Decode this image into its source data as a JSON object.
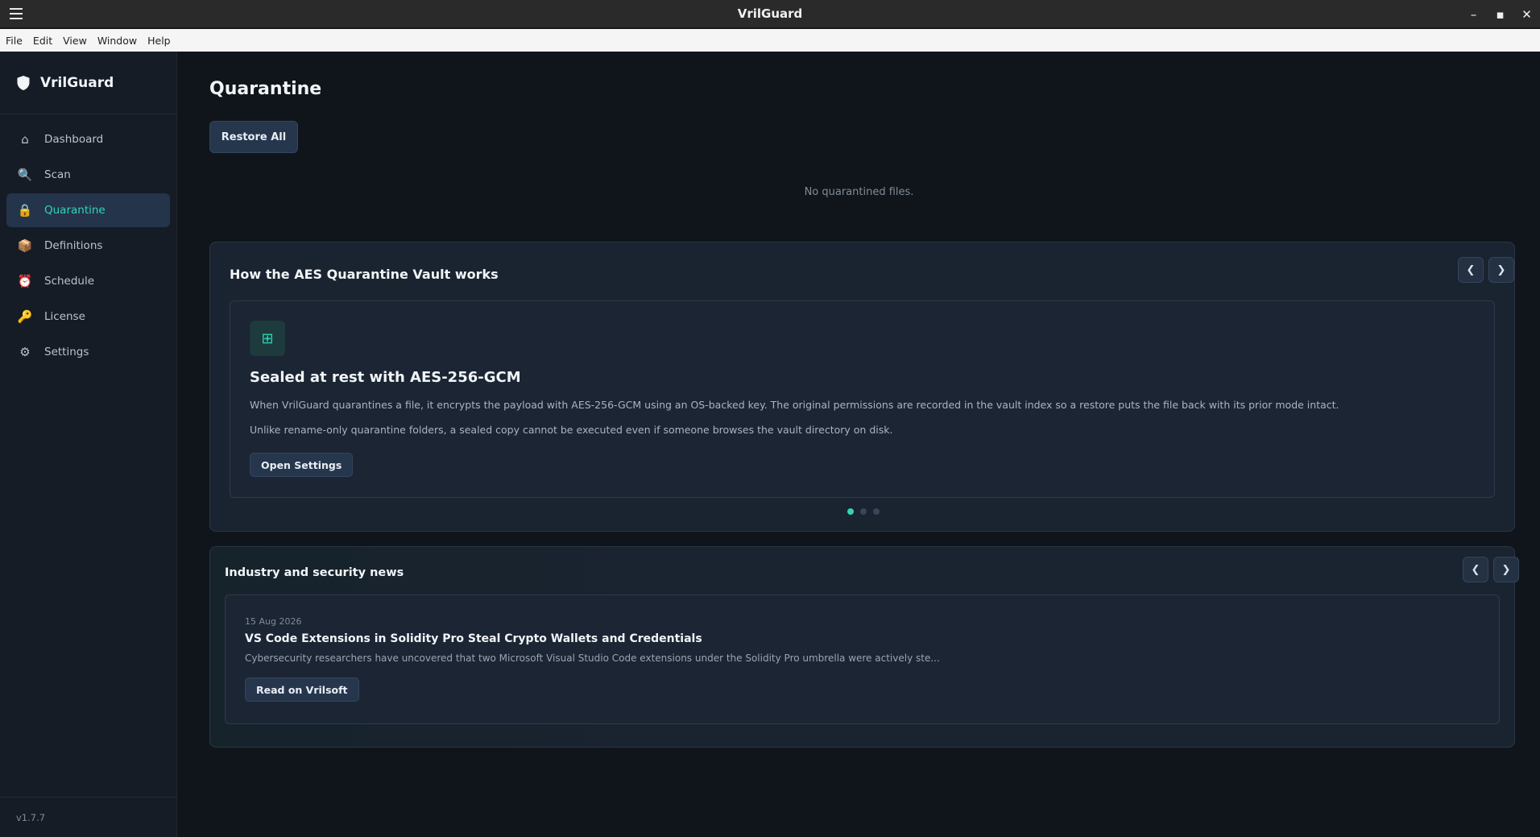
{
  "window": {
    "title": "VrilGuard"
  },
  "menu": [
    "File",
    "Edit",
    "View",
    "Window",
    "Help"
  ],
  "sidebar": {
    "brand": "VrilGuard",
    "items": [
      {
        "label": "Dashboard",
        "icon": "⌂"
      },
      {
        "label": "Scan",
        "icon": "🔍"
      },
      {
        "label": "Quarantine",
        "icon": "🔒"
      },
      {
        "label": "Definitions",
        "icon": "📦"
      },
      {
        "label": "Schedule",
        "icon": "⏰"
      },
      {
        "label": "License",
        "icon": "🔑"
      },
      {
        "label": "Settings",
        "icon": "⚙"
      }
    ],
    "active_index": 2,
    "version": "v1.7.7"
  },
  "main": {
    "title": "Quarantine",
    "restore_all_label": "Restore All",
    "empty_message": "No quarantined files."
  },
  "vault_carousel": {
    "title": "How the AES Quarantine Vault works",
    "prev": "❮",
    "next": "❯",
    "slide": {
      "icon": "⊞",
      "heading": "Sealed at rest with AES-256-GCM",
      "p1": "When VrilGuard quarantines a file, it encrypts the payload with AES-256-GCM using an OS-backed key. The original permissions are recorded in the vault index so a restore puts the file back with its prior mode intact.",
      "p2": "Unlike rename-only quarantine folders, a sealed copy cannot be executed even if someone browses the vault directory on disk.",
      "button": "Open Settings"
    },
    "dots_total": 3,
    "dots_active": 0
  },
  "news": {
    "title": "Industry and security news",
    "prev": "❮",
    "next": "❯",
    "item": {
      "date": "15 Aug 2026",
      "headline": "VS Code Extensions in Solidity Pro Steal Crypto Wallets and Credentials",
      "excerpt": "Cybersecurity researchers have uncovered that two Microsoft Visual Studio Code extensions under the Solidity Pro umbrella were actively ste...",
      "button": "Read on Vrilsoft"
    }
  },
  "colors": {
    "accent": "#2fd6b6",
    "background": "#10151b",
    "sidebar": "#151c26",
    "card": "#1a2330"
  }
}
